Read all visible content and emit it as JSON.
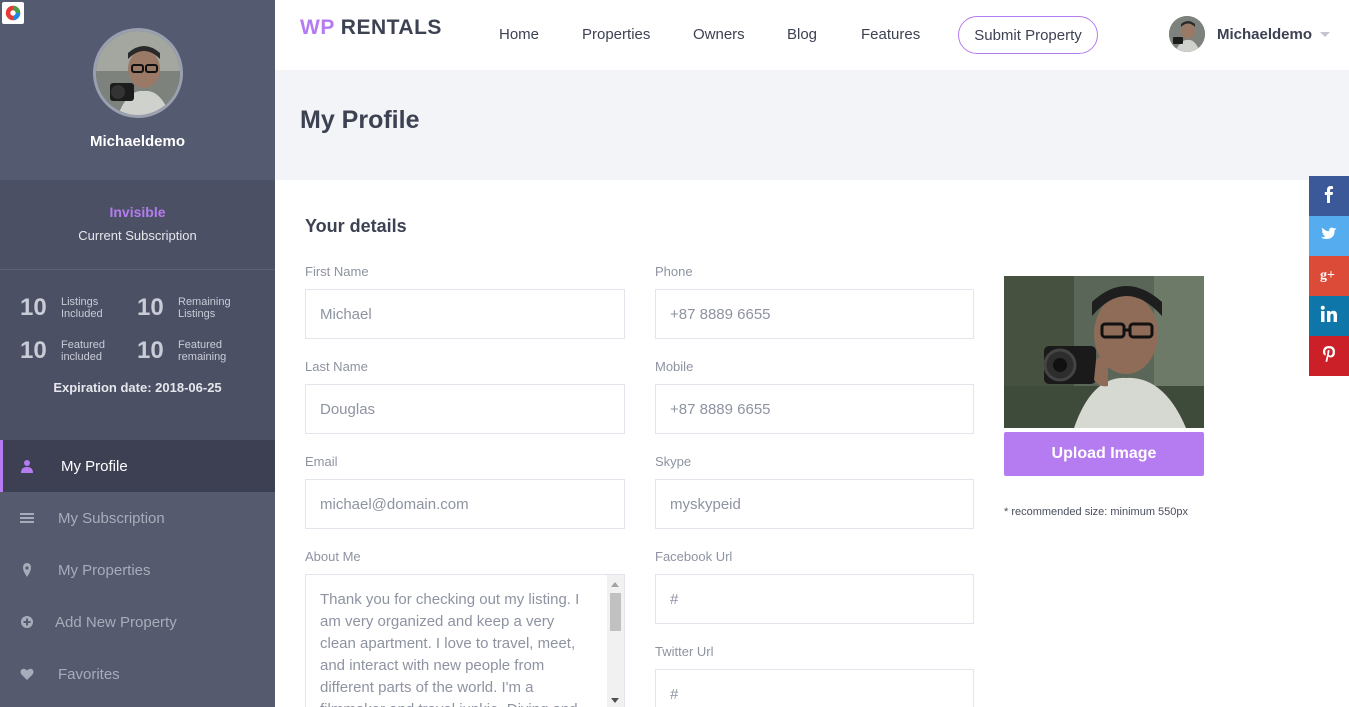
{
  "sidebar": {
    "user_name": "Michaeldemo",
    "subscription": {
      "plan": "Invisible",
      "label": "Current Subscription"
    },
    "stats": [
      {
        "num": "10",
        "label_line1": "Listings",
        "label_line2": "Included"
      },
      {
        "num": "10",
        "label_line1": "Remaining",
        "label_line2": "Listings"
      },
      {
        "num": "10",
        "label_line1": "Featured",
        "label_line2": "included"
      },
      {
        "num": "10",
        "label_line1": "Featured",
        "label_line2": "remaining"
      }
    ],
    "expiration": "Expiration date: 2018-06-25",
    "menu": [
      {
        "label": "My Profile",
        "icon": "user-icon"
      },
      {
        "label": "My Subscription",
        "icon": "list-icon"
      },
      {
        "label": "My Properties",
        "icon": "map-pin-icon"
      },
      {
        "label": "Add New Property",
        "icon": "plus-circle-icon"
      },
      {
        "label": "Favorites",
        "icon": "heart-icon"
      }
    ]
  },
  "header": {
    "brand_wp": "WP",
    "brand_rentals": "RENTALS",
    "nav": [
      "Home",
      "Properties",
      "Owners",
      "Blog",
      "Features"
    ],
    "submit_label": "Submit Property",
    "user_name": "Michaeldemo"
  },
  "page": {
    "title": "My Profile",
    "section_title": "Your details",
    "fields": {
      "first_name": {
        "label": "First Name",
        "value": "Michael"
      },
      "last_name": {
        "label": "Last Name",
        "value": "Douglas"
      },
      "email": {
        "label": "Email",
        "value": "michael@domain.com"
      },
      "about": {
        "label": "About Me",
        "value": "Thank you for checking out my listing. I am very organized and keep a very clean apartment. I love to travel, meet, and interact with new people from different parts of the world. I'm a filmmaker and travel junkie. Diving and being at the"
      },
      "phone": {
        "label": "Phone",
        "value": "+87 8889 6655"
      },
      "mobile": {
        "label": "Mobile",
        "value": "+87 8889 6655"
      },
      "skype": {
        "label": "Skype",
        "value": "myskypeid"
      },
      "facebook": {
        "label": "Facebook Url",
        "value": "#"
      },
      "twitter": {
        "label": "Twitter Url",
        "value": "#"
      }
    },
    "upload_label": "Upload Image",
    "recommended": "* recommended size: minimum 550px"
  },
  "colors": {
    "accent": "#b57bf0",
    "sidebar": "#555a6e",
    "sidebar_dark": "#4b5064",
    "facebook": "#3b5998",
    "twitter": "#55acee",
    "googleplus": "#dc4a38",
    "linkedin": "#0e76a8",
    "pinterest": "#cb2027"
  }
}
